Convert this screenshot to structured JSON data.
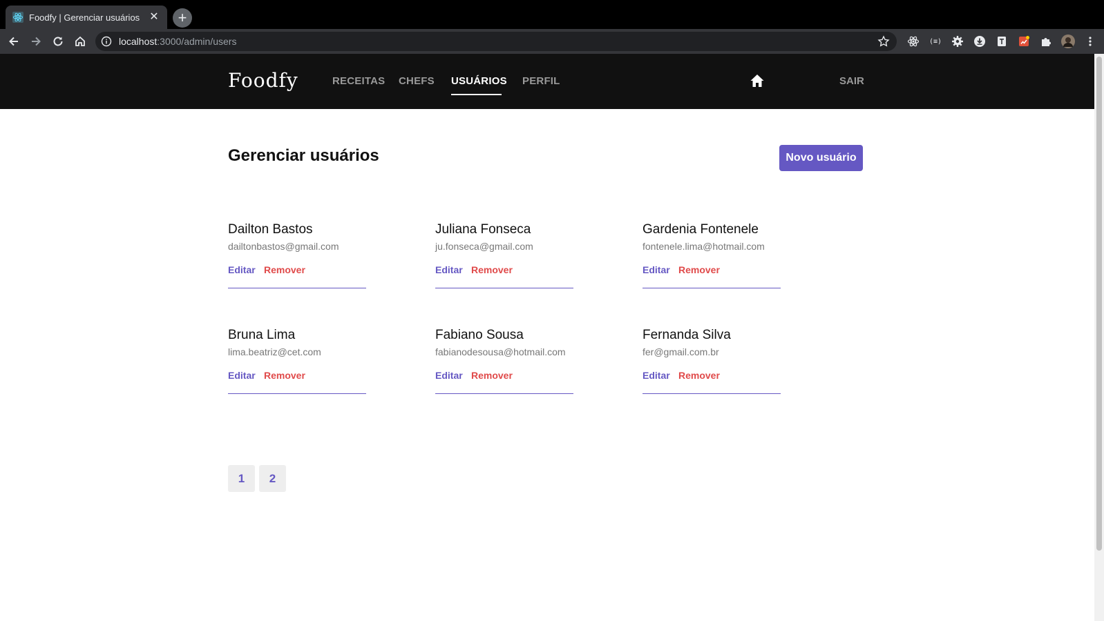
{
  "browser": {
    "tab_title": "Foodfy | Gerenciar usuários",
    "url_host": "localhost",
    "url_rest": ":3000/admin/users"
  },
  "header": {
    "logo": "Foodfy",
    "nav": [
      {
        "label": "RECEITAS",
        "active": false
      },
      {
        "label": "CHEFS",
        "active": false
      },
      {
        "label": "USUÁRIOS",
        "active": true
      },
      {
        "label": "PERFIL",
        "active": false
      }
    ],
    "logout_label": "SAIR"
  },
  "page": {
    "title": "Gerenciar usuários",
    "new_button_label": "Novo usuário"
  },
  "users": [
    {
      "name": "Dailton Bastos",
      "email": "dailtonbastos@gmail.com",
      "edit": "Editar",
      "remove": "Remover"
    },
    {
      "name": "Juliana Fonseca",
      "email": "ju.fonseca@gmail.com",
      "edit": "Editar",
      "remove": "Remover"
    },
    {
      "name": "Gardenia Fontenele",
      "email": "fontenele.lima@hotmail.com",
      "edit": "Editar",
      "remove": "Remover"
    },
    {
      "name": "Bruna Lima",
      "email": "lima.beatriz@cet.com",
      "edit": "Editar",
      "remove": "Remover"
    },
    {
      "name": "Fabiano Sousa",
      "email": "fabianodesousa@hotmail.com",
      "edit": "Editar",
      "remove": "Remover"
    },
    {
      "name": "Fernanda Silva",
      "email": "fer@gmail.com.br",
      "edit": "Editar",
      "remove": "Remover"
    }
  ],
  "pagination": [
    "1",
    "2"
  ],
  "colors": {
    "accent": "#6558c3",
    "danger": "#e04a4a",
    "header_bg": "#111111"
  }
}
